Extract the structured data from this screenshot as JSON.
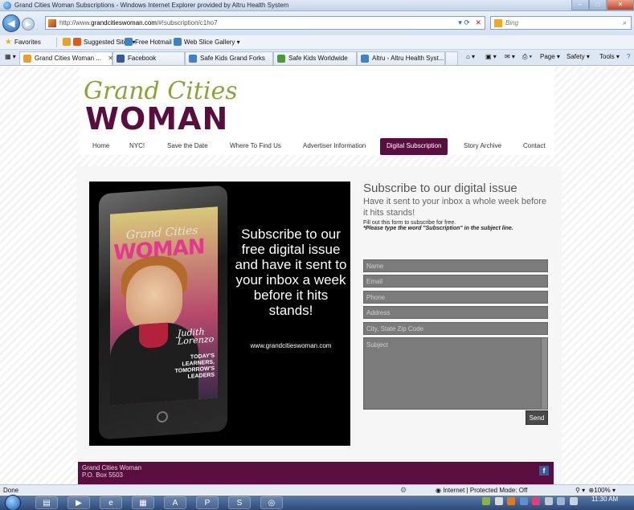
{
  "window": {
    "title": "Grand Cities Woman Subscriptions - Windows Internet Explorer provided by Altru Health System",
    "minimize_glyph": "–",
    "maximize_glyph": "□",
    "close_glyph": "✕"
  },
  "address": {
    "url_prefix": "http://www.",
    "url_domain": "grandcitieswoman.com",
    "url_path": "/#!subscription/c1ho7",
    "search_placeholder": "Bing"
  },
  "favorites_bar": {
    "favorites": "Favorites",
    "suggested": "Suggested Sites ▾",
    "hotmail": "Free Hotmail",
    "web_slice": "Web Slice Gallery ▾"
  },
  "tabs": [
    {
      "label": "Grand Cities Woman ...",
      "close": "✕"
    },
    {
      "label": "Facebook"
    },
    {
      "label": "Safe Kids Grand Forks"
    },
    {
      "label": "Safe Kids Worldwide"
    },
    {
      "label": "Altru - Altru Health Syst..."
    }
  ],
  "command_bar": {
    "page": "Page ▾",
    "safety": "Safety ▾",
    "tools": "Tools ▾"
  },
  "site": {
    "logo_script": "Grand Cities",
    "logo_word": "WOMAN",
    "nav": [
      {
        "label": "Home"
      },
      {
        "label": "NYC!"
      },
      {
        "label": "Save the Date"
      },
      {
        "label": "Where To Find Us"
      },
      {
        "label": "Advertiser Information"
      },
      {
        "label": "Digital Subscription"
      },
      {
        "label": "Story Archive"
      },
      {
        "label": "Contact"
      }
    ],
    "promo": {
      "cover_script": "Grand Cities",
      "cover_title": "WOMAN",
      "cover_name": "Judith\nLorenzo",
      "cover_line": "TODAY'S LEARNERS, TOMORROW'S LEADERS",
      "headline": "Subscribe to our free digital issue and have it sent to your inbox a week before it hits stands!",
      "url": "www.grandcitieswoman.com"
    },
    "form": {
      "title": "Subscribe to our digital issue",
      "subtitle": "Have it sent to your inbox a whole week before it hits stands!",
      "note": "Fill out this form to subscribe for free.",
      "note_bold": "*Please type the word \"Subscription\" in the subject line.",
      "fields": {
        "name": "Name",
        "email": "Email",
        "phone": "Phone",
        "address": "Address",
        "city": "City, State Zip Code",
        "subject": "Subject"
      },
      "send": "Send"
    },
    "footer": {
      "line1": "Grand Cities Woman",
      "line2": "P.O. Box 5503"
    }
  },
  "status": {
    "left": "Done",
    "zone": "Internet | Protected Mode: Off",
    "zoom": "100%"
  },
  "taskbar": {
    "clock_time": "11:30 AM"
  },
  "colors": {
    "brand_plum": "#5a0d3f",
    "logo_green": "#8aa33a",
    "field_gray": "#7b7b7b"
  }
}
